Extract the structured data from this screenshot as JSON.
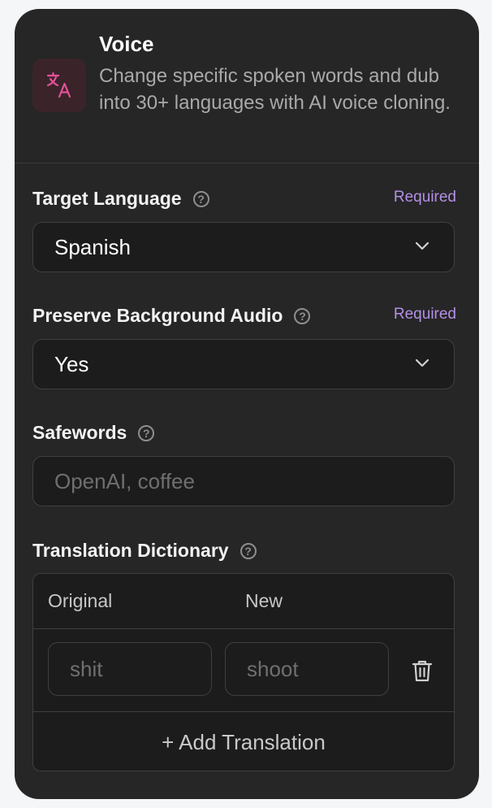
{
  "header": {
    "title": "Voice",
    "description": "Change specific spoken words and dub into 30+ languages with AI voice cloning."
  },
  "target_language": {
    "label": "Target Language",
    "required": "Required",
    "value": "Spanish"
  },
  "background_audio": {
    "label": "Preserve Background Audio",
    "required": "Required",
    "value": "Yes"
  },
  "safewords": {
    "label": "Safewords",
    "placeholder": "OpenAI, coffee"
  },
  "dictionary": {
    "label": "Translation Dictionary",
    "col_original": "Original",
    "col_new": "New",
    "row_original_placeholder": "shit",
    "row_new_placeholder": "shoot",
    "add_label": "+ Add Translation"
  },
  "help_glyph": "?",
  "colors": {
    "accent_required": "#b48fe6",
    "logo_pink": "#e5509a",
    "card_bg": "#262626"
  }
}
